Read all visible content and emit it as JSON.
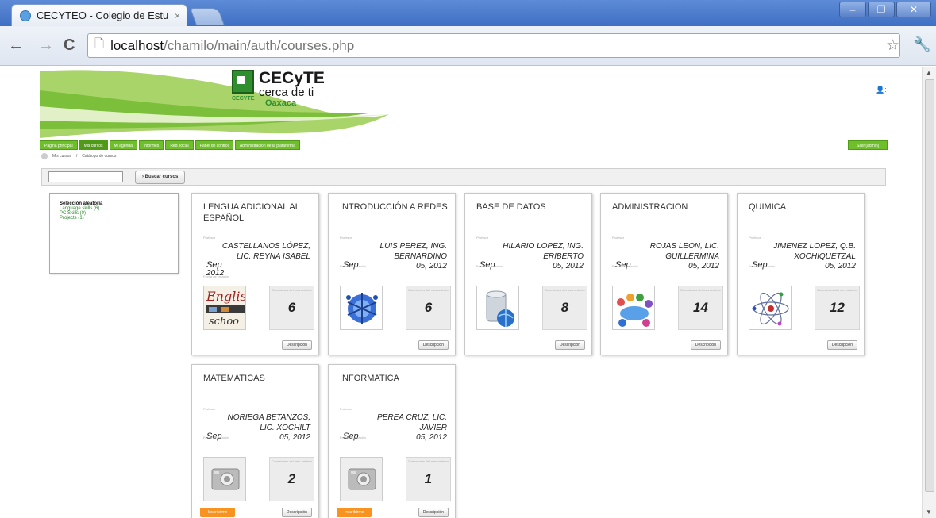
{
  "browser": {
    "tab_title": "CECYTEO - Colegio de Estu",
    "tab_close": "×",
    "url_host": "localhost",
    "url_path": "/chamilo/main/auth/courses.php"
  },
  "site": {
    "logo_main": "CECyTE",
    "logo_sub": "cerca de ti",
    "logo_loc": "Oaxaca",
    "logo_cap": "CECYTE",
    "menu": [
      "Página principal",
      "Mis cursos",
      "Mi agenda",
      "Informes",
      "Red social",
      "Panel de control",
      "Administración de la plataforma"
    ],
    "logout": "Salir (admin)",
    "breadcrumb": [
      "Mis cursos",
      "Catálogo de cursos"
    ]
  },
  "search": {
    "button": "Buscar cursos",
    "value": ""
  },
  "categories": {
    "title": "Selección aleatoria",
    "items": [
      "Language skills (6)",
      "PC Skills (0)",
      "Projects (1)"
    ]
  },
  "labels": {
    "professor": "Profesor",
    "created": "Fecha de creación",
    "stat_label": "Conexiones del mes anterior",
    "description": "Descripción",
    "subscribe": "Inscribirme"
  },
  "courses": [
    {
      "title": "LENGUA ADICIONAL AL ESPAÑOL",
      "professor": "CASTELLANOS LÓPEZ, LIC. REYNA ISABEL",
      "month": "Sep",
      "year": "2012",
      "date": "",
      "connections": "6",
      "image": "english-school"
    },
    {
      "title": "INTRODUCCIÓN A REDES",
      "professor": "LUIS PEREZ, ING. BERNARDINO",
      "month": "Sep",
      "year": "",
      "date": "05, 2012",
      "connections": "6",
      "image": "network-globe"
    },
    {
      "title": "BASE DE DATOS",
      "professor": "HILARIO LOPEZ, ING. ERIBERTO",
      "month": "Sep",
      "year": "",
      "date": "05, 2012",
      "connections": "8",
      "image": "database"
    },
    {
      "title": "ADMINISTRACION",
      "professor": "ROJAS LEON, LIC. GUILLERMINA",
      "month": "Sep",
      "year": "",
      "date": "05, 2012",
      "connections": "14",
      "image": "people-meeting"
    },
    {
      "title": "QUIMICA",
      "professor": "JIMENEZ LOPEZ, Q.B. XOCHIQUETZAL",
      "month": "Sep",
      "year": "",
      "date": "05, 2012",
      "connections": "12",
      "image": "atom"
    },
    {
      "title": "MATEMATICAS",
      "professor": "NORIEGA BETANZOS, LIC. XOCHILT",
      "month": "Sep",
      "year": "",
      "date": "05, 2012",
      "connections": "2",
      "image": "placeholder",
      "subscribe": true
    },
    {
      "title": "INFORMATICA",
      "professor": "PEREA CRUZ, LIC. JAVIER",
      "month": "Sep",
      "year": "",
      "date": "05, 2012",
      "connections": "1",
      "image": "placeholder",
      "subscribe": true
    }
  ]
}
